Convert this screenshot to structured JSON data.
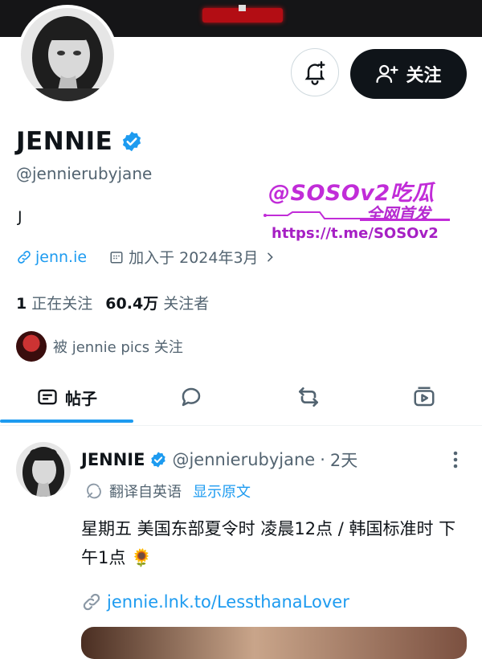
{
  "profile": {
    "name": "JENNIE",
    "handle": "@jennierubyjane",
    "bio": "J",
    "link_text": "jenn.ie",
    "joined_text": "加入于 2024年3月",
    "following_count": "1",
    "following_label": "正在关注",
    "followers_count": "60.4万",
    "followers_label": "关注者",
    "followed_by_text": "被 jennie pics 关注",
    "follow_button_label": "关注"
  },
  "tabs": [
    {
      "label": "帖子",
      "icon": "posts-icon",
      "active": true
    },
    {
      "label": "",
      "icon": "replies-icon",
      "active": false
    },
    {
      "label": "",
      "icon": "retweet-icon",
      "active": false
    },
    {
      "label": "",
      "icon": "media-icon",
      "active": false
    }
  ],
  "post": {
    "author_name": "JENNIE",
    "author_handle": "@jennierubyjane",
    "separator": "·",
    "time": "2天",
    "translated_label": "翻译自英语",
    "show_original": "显示原文",
    "text": "星期五 美国东部夏令时 凌晨12点 / 韩国标准时 下午1点 🌻",
    "link_text": "jennie.lnk.to/LessthanaLover"
  },
  "watermark": {
    "title": "@SOSOv2吃瓜",
    "subtitle": "全网首发",
    "url": "https://t.me/SOSOv2"
  },
  "colors": {
    "accent": "#1d9bf0",
    "text_primary": "#0f1419",
    "text_secondary": "#536471",
    "watermark": "#c12cd8"
  }
}
